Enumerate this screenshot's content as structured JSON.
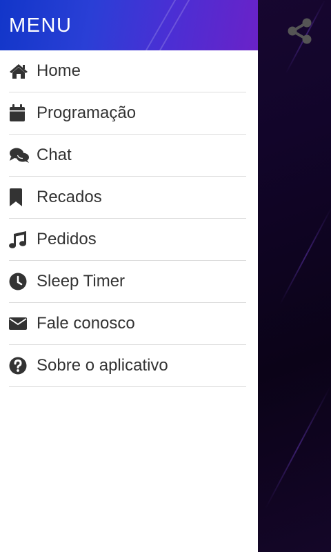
{
  "drawer": {
    "title": "MENU",
    "items": [
      {
        "label": "Home",
        "icon": "home-icon"
      },
      {
        "label": "Programação",
        "icon": "calendar-icon"
      },
      {
        "label": "Chat",
        "icon": "chat-icon"
      },
      {
        "label": "Recados",
        "icon": "bookmark-icon"
      },
      {
        "label": "Pedidos",
        "icon": "music-note-icon"
      },
      {
        "label": "Sleep Timer",
        "icon": "clock-icon"
      },
      {
        "label": "Fale conosco",
        "icon": "envelope-icon"
      },
      {
        "label": "Sobre o aplicativo",
        "icon": "question-circle-icon"
      }
    ]
  },
  "toolbar": {
    "share_icon": "share-icon"
  },
  "colors": {
    "header_gradient_start": "#1236c9",
    "header_gradient_end": "#6a22c8",
    "background": "#12052a",
    "text": "#333333",
    "divider": "#dcdcdc"
  }
}
